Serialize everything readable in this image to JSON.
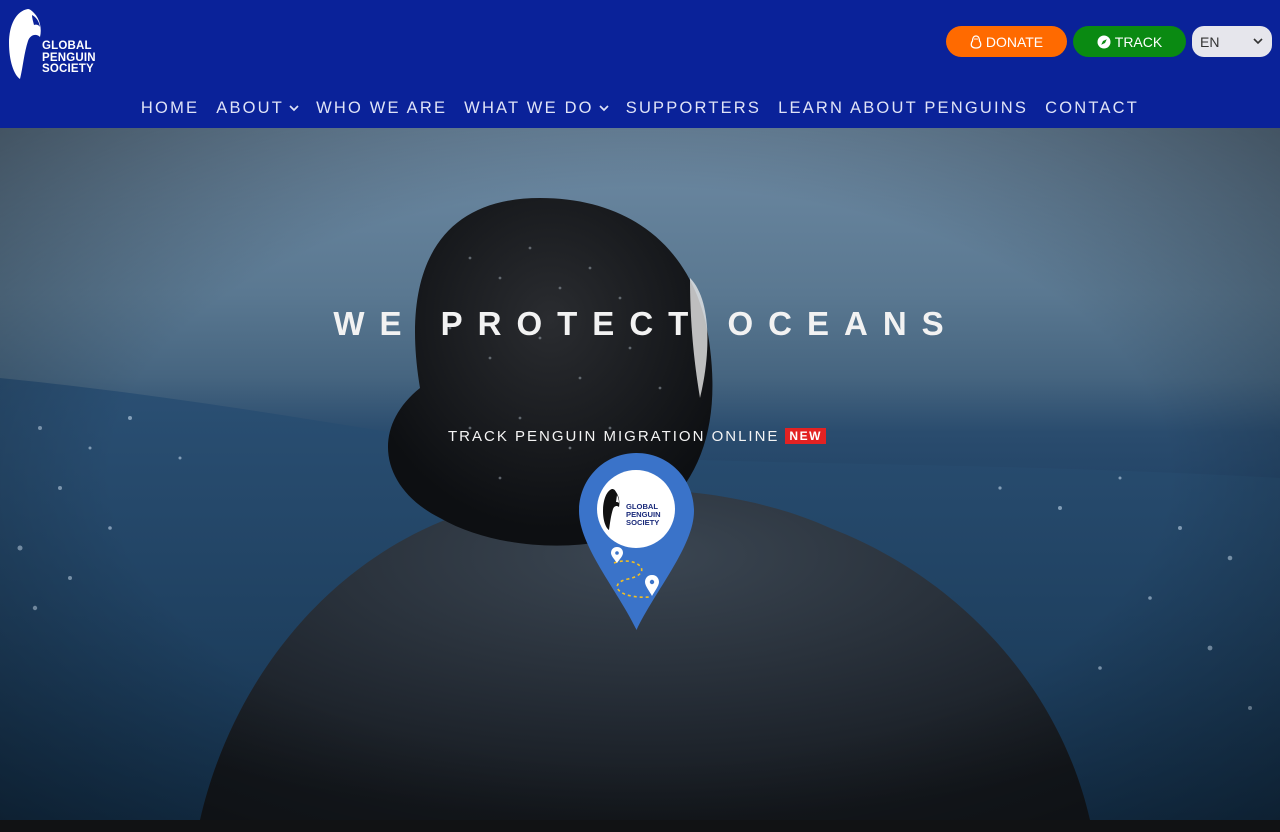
{
  "brand": {
    "name_line1": "GLOBAL",
    "name_line2": "PENGUIN",
    "name_line3": "SOCIETY",
    "logo_icon": "penguin-logo-icon"
  },
  "header_buttons": {
    "donate_label": "DONATE",
    "donate_icon": "penguin-icon",
    "donate_color": "#ff6a00",
    "track_label": "TRACK",
    "track_icon": "compass-icon",
    "track_color": "#0a8a12"
  },
  "language": {
    "selected": "EN"
  },
  "nav": {
    "items": [
      {
        "label": "HOME"
      },
      {
        "label": "ABOUT"
      },
      {
        "label": "WHO WE ARE"
      },
      {
        "label": "WHAT WE DO"
      },
      {
        "label": "SUPPORTERS"
      },
      {
        "label": "LEARN ABOUT PENGUINS"
      },
      {
        "label": "CONTACT"
      }
    ]
  },
  "hero": {
    "title": "WE PROTECT OCEANS",
    "track_text": "TRACK PENGUIN MIGRATION ONLINE",
    "badge": "NEW",
    "pin_logo": {
      "line1": "GLOBAL",
      "line2": "PENGUIN",
      "line3": "SOCIETY"
    }
  },
  "colors": {
    "header_bg": "#0a2299",
    "badge_red": "#e32222",
    "pin_blue": "#3a73c9"
  }
}
